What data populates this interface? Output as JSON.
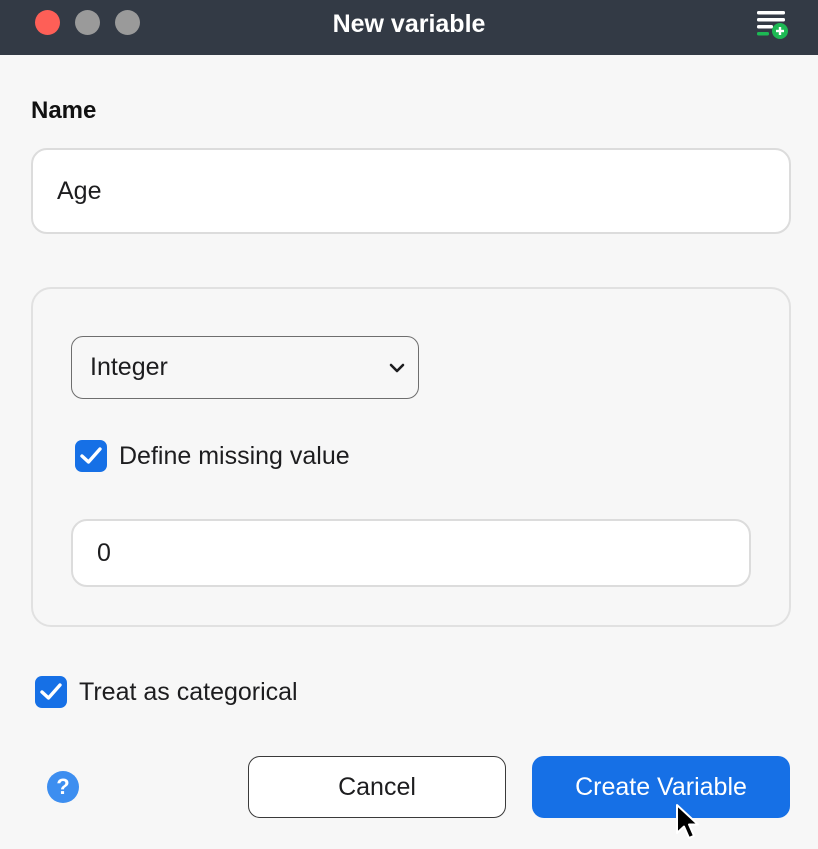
{
  "window": {
    "title": "New variable",
    "icons": {
      "close": "close-traffic-light",
      "minimize": "minimize-traffic-light",
      "zoom": "zoom-traffic-light",
      "titlebar_action": "add-variable-list-icon"
    }
  },
  "form": {
    "name_label": "Name",
    "name_value": "Age",
    "type_select": {
      "selected": "Integer",
      "icon": "chevron-down-icon"
    },
    "define_missing": {
      "label": "Define missing value",
      "checked": true
    },
    "missing_value": "0",
    "treat_categorical": {
      "label": "Treat as categorical",
      "checked": true
    }
  },
  "footer": {
    "help_glyph": "?",
    "cancel_label": "Cancel",
    "create_label": "Create Variable"
  },
  "colors": {
    "titlebar": "#333a45",
    "accent": "#1670e6",
    "close_button": "#fe5f57",
    "help": "#3d8ef0",
    "add_badge": "#1db954"
  }
}
